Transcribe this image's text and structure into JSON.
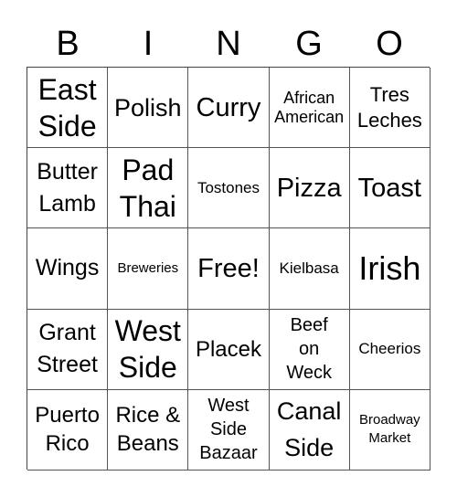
{
  "card": {
    "header": [
      "B",
      "I",
      "N",
      "G",
      "O"
    ],
    "rows": [
      [
        {
          "text": "East\nSide",
          "size": "s32"
        },
        {
          "text": "Polish",
          "size": "s27"
        },
        {
          "text": "Curry",
          "size": "s29"
        },
        {
          "text": "African\nAmerican",
          "size": "s18"
        },
        {
          "text": "Tres\nLeches",
          "size": "s22"
        }
      ],
      [
        {
          "text": "Butter\nLamb",
          "size": "s25"
        },
        {
          "text": "Pad\nThai",
          "size": "s32"
        },
        {
          "text": "Tostones",
          "size": "s16"
        },
        {
          "text": "Pizza",
          "size": "s29"
        },
        {
          "text": "Toast",
          "size": "s29"
        }
      ],
      [
        {
          "text": "Wings",
          "size": "s25"
        },
        {
          "text": "Breweries",
          "size": "s15"
        },
        {
          "text": "Free!",
          "size": "s29"
        },
        {
          "text": "Kielbasa",
          "size": "s16"
        },
        {
          "text": "Irish",
          "size": "s36"
        }
      ],
      [
        {
          "text": "Grant\nStreet",
          "size": "s25"
        },
        {
          "text": "West\nSide",
          "size": "s32"
        },
        {
          "text": "Placek",
          "size": "s24"
        },
        {
          "text": "Beef\non\nWeck",
          "size": "s20"
        },
        {
          "text": "Cheerios",
          "size": "s16"
        }
      ],
      [
        {
          "text": "Puerto\nRico",
          "size": "s24"
        },
        {
          "text": "Rice &\nBeans",
          "size": "s24"
        },
        {
          "text": "West\nSide\nBazaar",
          "size": "s20"
        },
        {
          "text": "Canal\nSide",
          "size": "s27"
        },
        {
          "text": "Broadway\nMarket",
          "size": "s15"
        }
      ]
    ]
  }
}
